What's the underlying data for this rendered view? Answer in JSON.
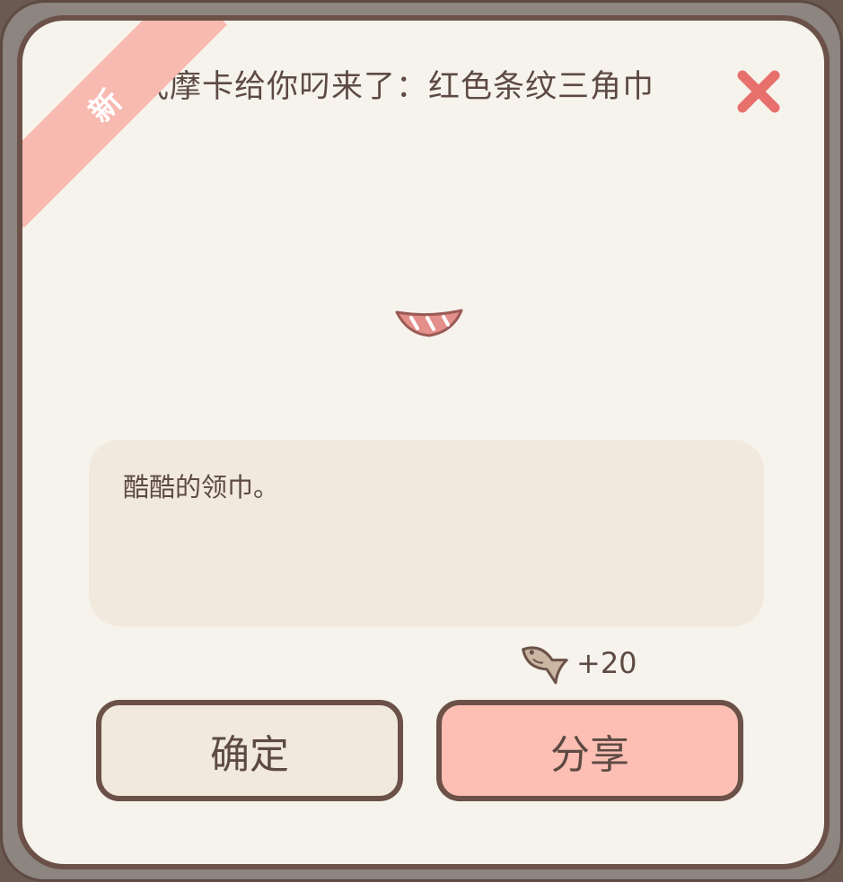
{
  "dialog": {
    "badge": "新",
    "title": "武摩卡给你叼来了：红色条纹三角巾",
    "close_icon": "close-x-icon",
    "item_icon": "red-striped-bandana-icon",
    "description": "酷酷的领巾。",
    "reward": {
      "icon": "fish-icon",
      "value": "+20"
    },
    "buttons": {
      "confirm_label": "确定",
      "share_label": "分享"
    }
  },
  "colors": {
    "frame": "#8d857f",
    "border": "#6b5148",
    "panel": "#f6f3ec",
    "ribbon": "#f8b9b0",
    "description_bg": "#f1e9de",
    "share_button": "#fdbfb4",
    "close_icon": "#e8706c",
    "text": "#5d4a43"
  }
}
